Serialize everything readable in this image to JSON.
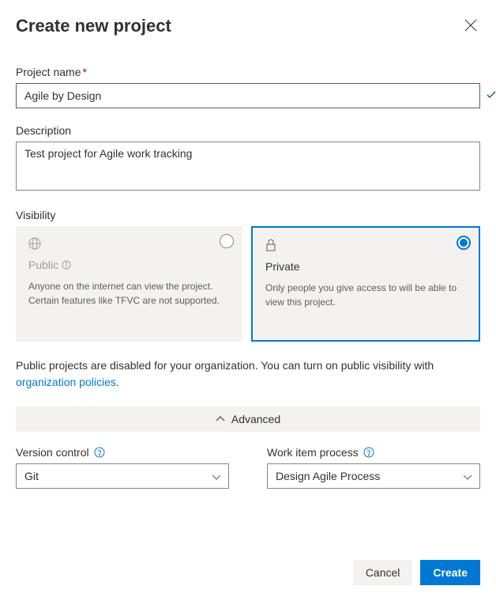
{
  "header": {
    "title": "Create new project"
  },
  "projectName": {
    "label": "Project name",
    "value": "Agile by Design",
    "required": "*"
  },
  "description": {
    "label": "Description",
    "value": "Test project for Agile work tracking"
  },
  "visibility": {
    "label": "Visibility",
    "options": [
      {
        "title": "Public",
        "desc": "Anyone on the internet can view the project. Certain features like TFVC are not supported.",
        "selected": false,
        "disabled": true
      },
      {
        "title": "Private",
        "desc": "Only people you give access to will be able to view this project.",
        "selected": true,
        "disabled": false
      }
    ]
  },
  "notice": {
    "text": "Public projects are disabled for your organization. You can turn on public visibility with ",
    "linkText": "organization policies",
    "suffix": "."
  },
  "advanced": {
    "label": "Advanced"
  },
  "versionControl": {
    "label": "Version control",
    "value": "Git"
  },
  "workItemProcess": {
    "label": "Work item process",
    "value": "Design Agile Process"
  },
  "footer": {
    "cancel": "Cancel",
    "create": "Create"
  }
}
